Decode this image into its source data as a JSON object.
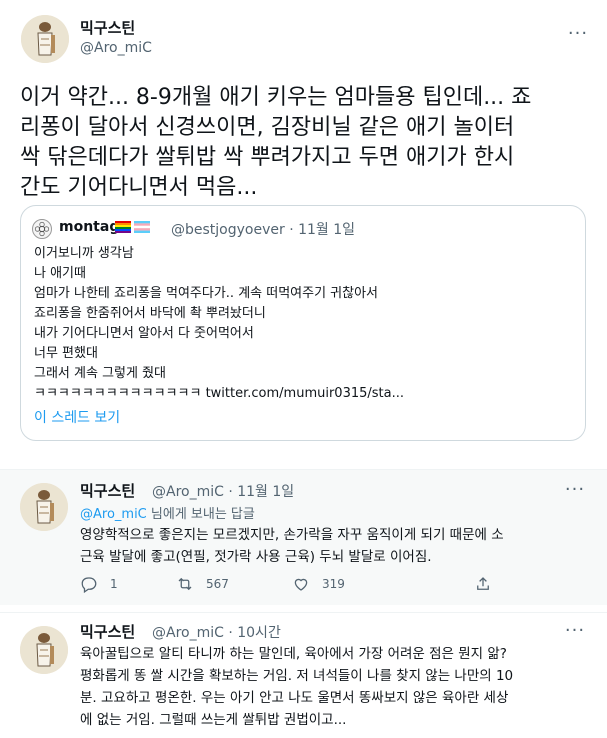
{
  "main_tweet": {
    "name": "믹구스틴",
    "handle": "@Aro_miC",
    "text_lines": [
      "이거 약간... 8-9개월 애기 키우는 엄마들용 팁인데... 죠",
      "리퐁이 달아서 신경쓰이면, 김장비닐 같은 애기 놀이터",
      "싹 닦은데다가 쌀튀밥 싹 뿌려가지고 두면 애기가 한시",
      "간도 기어다니면서 먹음..."
    ]
  },
  "quote": {
    "name": "montag",
    "handle_time": "@bestjogyoever · 11월 1일",
    "lines": [
      "이거보니까 생각남",
      "나 애기때",
      "엄마가 나한테 죠리퐁을 먹여주다가.. 계속 떠먹여주기 귀찮아서",
      "죠리퐁을 한줌쥐어서 바닥에 촥 뿌려놨더니",
      "내가 기어다니면서 알아서 다 줏어먹어서",
      "너무 편했대",
      "그래서 계속 그렇게 줬대"
    ],
    "last_line_prefix": "ㅋㅋㅋㅋㅋㅋㅋㅋㅋㅋㅋㅋㅋㅋ ",
    "last_line_link": "twitter.com/mumuir0315/sta...",
    "thread_link": "이 스레드 보기"
  },
  "reply1": {
    "name": "믹구스틴",
    "handle_time": "@Aro_miC · 11월 1일",
    "replying_mention": "@Aro_miC",
    "replying_suffix": " 님에게 보내는 답글",
    "text_lines": [
      "영양학적으로 좋은지는 모르겠지만, 손가락을 자꾸 움직이게 되기 때문에 소",
      "근육 발달에 좋고(연필, 젓가락 사용 근육) 두뇌 발달로 이어짐."
    ],
    "replies": "1",
    "retweets": "567",
    "likes": "319"
  },
  "reply2": {
    "name": "믹구스틴",
    "handle_time": "@Aro_miC · 10시간",
    "text_lines": [
      "육아꿀팁으로 알티 타니까 하는 말인데, 육아에서 가장 어려운 점은 뭔지 앎?",
      "평화롭게 똥 쌀 시간을 확보하는 거임. 저 녀석들이 나를 찾지 않는 나만의 10",
      "분. 고요하고 평온한. 우는 아기 안고 나도 울면서 똥싸보지 않은 육아란 세상",
      "에 없는 거임. 그럴때 쓰는게 쌀튀밥 권법이고..."
    ]
  },
  "icons": {
    "more": "more-horizontal-icon",
    "reply": "reply-icon",
    "retweet": "retweet-icon",
    "like": "heart-icon",
    "share": "share-icon"
  },
  "colors": {
    "accent": "#1d9bf0",
    "secondary_text": "#536471",
    "border": "#cfd9de",
    "reply_bg": "#f7f9f9"
  }
}
